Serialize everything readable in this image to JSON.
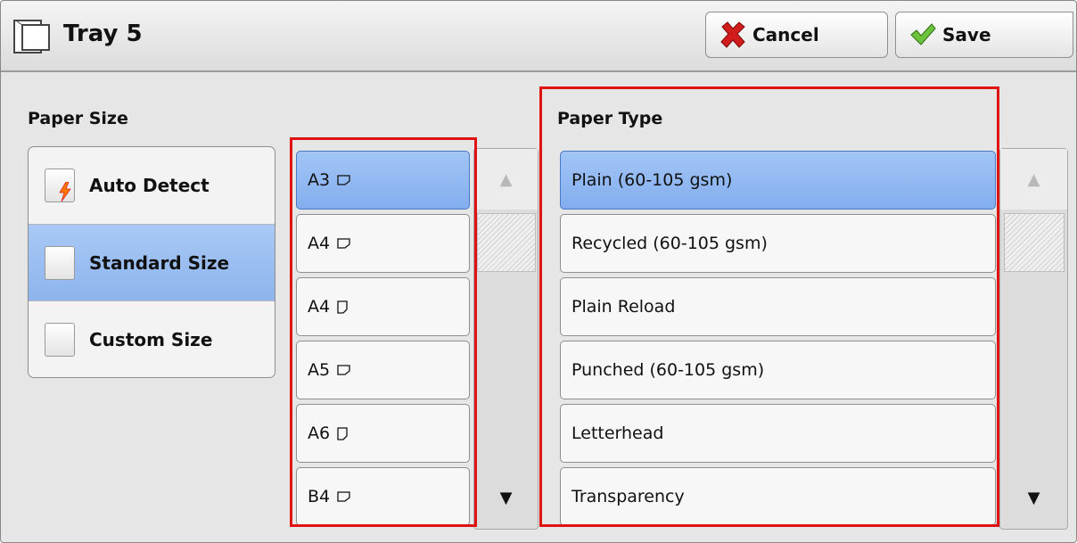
{
  "header": {
    "title": "Tray 5",
    "cancel_label": "Cancel",
    "save_label": "Save"
  },
  "paper_size": {
    "label": "Paper Size",
    "options": [
      {
        "label": "Auto Detect",
        "selected": false
      },
      {
        "label": "Standard Size",
        "selected": true
      },
      {
        "label": "Custom Size",
        "selected": false
      }
    ],
    "sizes": [
      {
        "label": "A3",
        "orientation": "landscape",
        "selected": true
      },
      {
        "label": "A4",
        "orientation": "landscape",
        "selected": false
      },
      {
        "label": "A4",
        "orientation": "portrait",
        "selected": false
      },
      {
        "label": "A5",
        "orientation": "landscape",
        "selected": false
      },
      {
        "label": "A6",
        "orientation": "portrait",
        "selected": false
      },
      {
        "label": "B4",
        "orientation": "landscape",
        "selected": false
      }
    ],
    "scroll_up_icon": "▲",
    "scroll_down_icon": "▼"
  },
  "paper_type": {
    "label": "Paper Type",
    "types": [
      {
        "label": "Plain (60-105 gsm)",
        "selected": true
      },
      {
        "label": "Recycled (60-105 gsm)",
        "selected": false
      },
      {
        "label": "Plain Reload",
        "selected": false
      },
      {
        "label": "Punched (60-105 gsm)",
        "selected": false
      },
      {
        "label": "Letterhead",
        "selected": false
      },
      {
        "label": "Transparency",
        "selected": false
      }
    ],
    "scroll_up_icon": "▲",
    "scroll_down_icon": "▼"
  },
  "colors": {
    "selection": "#8db4ee",
    "highlight": "#e01313",
    "cancel_icon": "#d21b1b",
    "save_icon": "#5bb52d"
  }
}
